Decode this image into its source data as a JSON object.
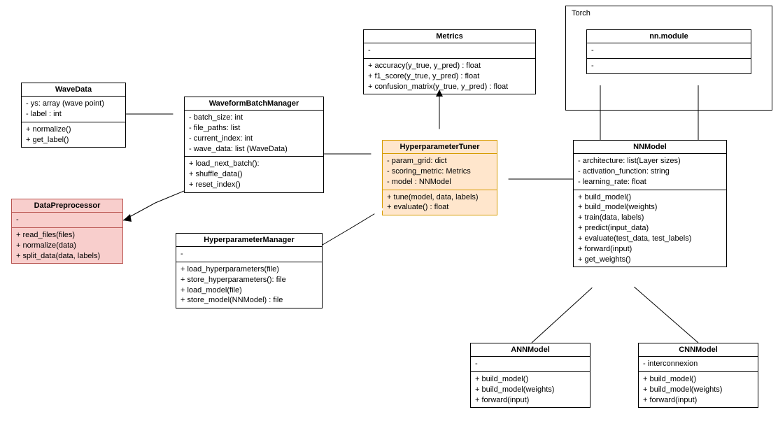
{
  "package": {
    "label": "Torch"
  },
  "classes": {
    "waveData": {
      "name": "WaveData",
      "attrs": "- ys: array (wave point)\n- label : int",
      "ops": "+ normalize()\n+ get_label()"
    },
    "dataPreprocessor": {
      "name": "DataPreprocessor",
      "attrs": "-",
      "ops": "+ read_files(files)\n+ normalize(data)\n+ split_data(data, labels)"
    },
    "waveformBatchManager": {
      "name": "WaveformBatchManager",
      "attrs": "- batch_size: int\n- file_paths: list\n- current_index: int\n- wave_data: list (WaveData)",
      "ops": "+ load_next_batch():\n+ shuffle_data()\n+ reset_index()"
    },
    "hyperparameterManager": {
      "name": "HyperparameterManager",
      "attrs": "-",
      "ops": "+ load_hyperparameters(file)\n+ store_hyperparameters(): file\n+ load_model(file)\n+ store_model(NNModel) : file"
    },
    "metrics": {
      "name": "Metrics",
      "attrs": "-",
      "ops": "+ accuracy(y_true, y_pred) : float\n+ f1_score(y_true, y_pred) : float\n+ confusion_matrix(y_true, y_pred) : float"
    },
    "hyperparameterTuner": {
      "name": "HyperparameterTuner",
      "attrs": "- param_grid: dict\n- scoring_metric: Metrics\n- model : NNModel",
      "ops": "+ tune(model, data, labels)\n+ evaluate() : float"
    },
    "nnModule": {
      "name": "nn.module",
      "attrs": "-",
      "ops": "-"
    },
    "nnModel": {
      "name": "NNModel",
      "attrs": "- architecture: list(Layer sizes)\n- activation_function: string\n- learning_rate: float",
      "ops": "+ build_model()\n+ build_model(weights)\n+ train(data, labels)\n+ predict(input_data)\n+ evaluate(test_data, test_labels)\n+ forward(input)\n+ get_weights()"
    },
    "annModel": {
      "name": "ANNModel",
      "attrs": "-",
      "ops": "+ build_model()\n+ build_model(weights)\n+ forward(input)"
    },
    "cnnModel": {
      "name": "CNNModel",
      "attrs": "- interconnexion",
      "ops": "+ build_model()\n+ build_model(weights)\n+ forward(input)"
    }
  }
}
